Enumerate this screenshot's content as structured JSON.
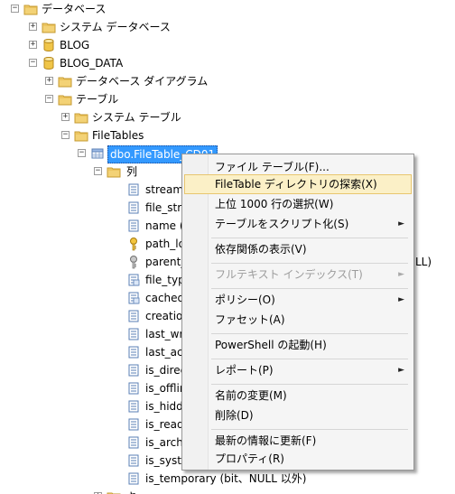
{
  "tree": {
    "root": {
      "label": "データベース"
    },
    "system_db": {
      "label": "システム データベース"
    },
    "blog": {
      "label": "BLOG"
    },
    "blog_data": {
      "label": "BLOG_DATA"
    },
    "diagrams": {
      "label": "データベース ダイアグラム"
    },
    "tables": {
      "label": "テーブル"
    },
    "system_tables": {
      "label": "システム テーブル"
    },
    "filetables": {
      "label": "FileTables"
    },
    "selected_table": {
      "label": "dbo.FileTable_CD01"
    },
    "columns_folder": {
      "label": "列"
    },
    "columns": [
      {
        "label": "stream"
      },
      {
        "label": "file_str"
      },
      {
        "label": "name ("
      },
      {
        "label": "path_lo"
      },
      {
        "label": "parent_"
      },
      {
        "label": "file_typ"
      },
      {
        "label": "cached_"
      },
      {
        "label": "creatio"
      },
      {
        "label": "last_wr"
      },
      {
        "label": "last_ac"
      },
      {
        "label": "is_direc"
      },
      {
        "label": "is_offlir"
      },
      {
        "label": "is_hidd"
      },
      {
        "label": "is_read"
      },
      {
        "label": "is_arch"
      },
      {
        "label": "is_syst"
      },
      {
        "label": "is_temporary (bit、NULL 以外)"
      }
    ],
    "parent_suffix": "LL)",
    "partial_bottom": "キ"
  },
  "context_menu": {
    "items": {
      "file_table": "ファイル テーブル(F)...",
      "explore_dir": "FileTable ディレクトリの探索(X)",
      "select_top": "上位 1000 行の選択(W)",
      "script_as": "テーブルをスクリプト化(S)",
      "dependencies": "依存関係の表示(V)",
      "fulltext": "フルテキスト インデックス(T)",
      "policies": "ポリシー(O)",
      "facets": "ファセット(A)",
      "powershell": "PowerShell の起動(H)",
      "reports": "レポート(P)",
      "rename": "名前の変更(M)",
      "delete": "削除(D)",
      "refresh": "最新の情報に更新(F)",
      "properties": "プロパティ(R)"
    },
    "submenu_arrow": "►",
    "highlight_color": "#fbf0c7"
  },
  "expander": {
    "expanded": "−",
    "collapsed": "+"
  }
}
